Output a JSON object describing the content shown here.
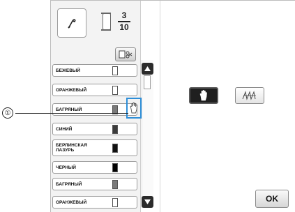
{
  "callout": {
    "number": "①"
  },
  "header": {
    "spool_current": "3",
    "spool_total": "10",
    "preview_icon": "embroidery-needle-icon",
    "thread_cut_icon": "scissors-thread-icon"
  },
  "thread_colors": [
    {
      "name": "БЕЖЕВЫЙ",
      "swatch": "#ffffff"
    },
    {
      "name": "ОРАНЖЕВЫЙ",
      "swatch": "#ffffff"
    },
    {
      "name": "БАГРЯНЫЙ",
      "swatch": "#7a7a7a"
    },
    {
      "name": "СИНИЙ",
      "swatch": "#3a3a3a"
    },
    {
      "name": "БЕРЛИНСКАЯ ЛАЗУРЬ",
      "swatch": "#111111"
    },
    {
      "name": "ЧЕРНЫЙ",
      "swatch": "#000000"
    },
    {
      "name": "БАГРЯНЫЙ",
      "swatch": "#7a7a7a"
    },
    {
      "name": "ОРАНЖЕВЫЙ",
      "swatch": "#ffffff"
    }
  ],
  "controls": {
    "hand_icon": "hand-icon",
    "stitch_icon": "zigzag-stitch-icon",
    "ok_label": "OK"
  },
  "colors": {
    "highlight": "#2f8fd8",
    "selected_button": "#1f1f1f"
  }
}
